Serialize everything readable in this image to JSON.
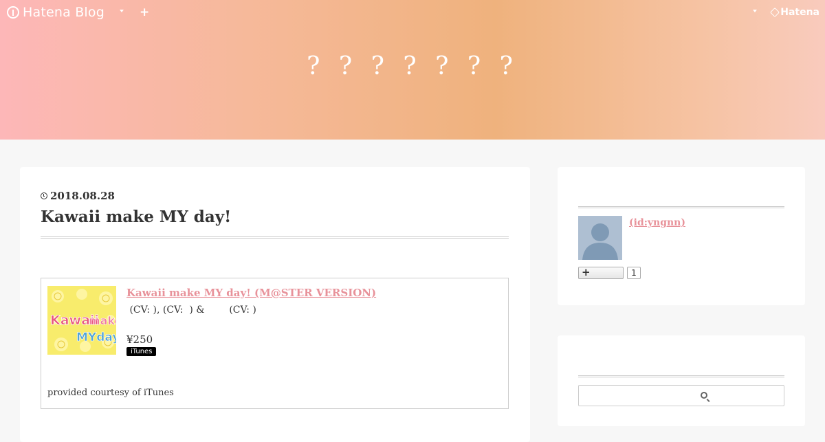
{
  "topbar": {
    "logo_text": "Hatena Blog",
    "add_label": "+",
    "hatena_label": "Hatena"
  },
  "header": {
    "blog_title": "? ? ? ? ? ? ?"
  },
  "entry": {
    "date": "2018.08.28",
    "title": "Kawaii make MY day!",
    "itunes": {
      "track_title": "Kawaii make MY day! (M@STER VERSION)",
      "artist_line": " (CV: ), (CV:  ) &        (CV: )",
      "price": "¥250",
      "badge": "iTunes",
      "courtesy": "provided courtesy of iTunes"
    }
  },
  "sidebar": {
    "profile": {
      "name_link": " (id:yngnn)",
      "follow_icon": "+",
      "follow_count": "1"
    },
    "search": {
      "placeholder": ""
    }
  },
  "colors": {
    "link": "#e8929a",
    "header_gradient": [
      "#fdb7b8",
      "#efb27d",
      "#f9cbbd"
    ]
  }
}
